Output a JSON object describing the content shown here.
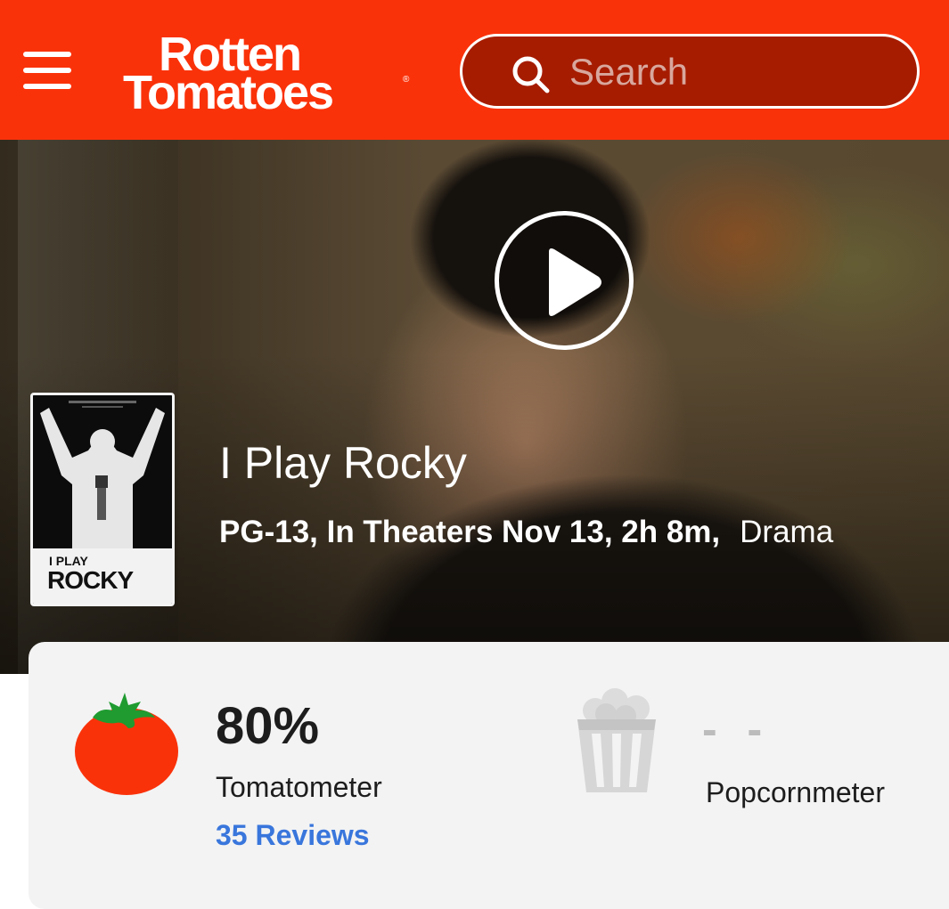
{
  "header": {
    "logo_line1": "Rotten",
    "logo_line2": "Tomatoes",
    "logo_reg": "®",
    "search_placeholder": "Search"
  },
  "movie": {
    "title": "I Play Rocky",
    "rating_release_runtime": "PG-13, In Theaters Nov 13, 2h 8m,",
    "genre": "Drama",
    "poster": {
      "title_line1": "I PLAY",
      "title_line2": "ROCKY"
    }
  },
  "scores": {
    "tomatometer": {
      "score": "80%",
      "label": "Tomatometer",
      "reviews": "35 Reviews"
    },
    "popcornmeter": {
      "score": "- -",
      "label": "Popcornmeter"
    }
  },
  "colors": {
    "brand_red": "#fa320a",
    "search_bg": "#a61c00",
    "link_blue": "#3976dc"
  }
}
